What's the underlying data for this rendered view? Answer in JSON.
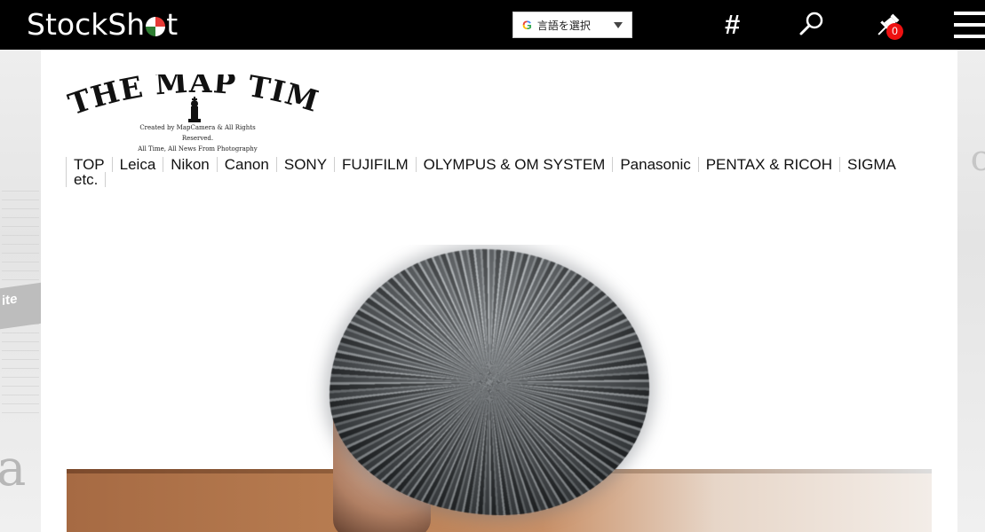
{
  "header": {
    "brand_left": "Stock",
    "brand_right": "Sh",
    "brand_tail": "t",
    "language_select": {
      "label": "言語を選択"
    },
    "hash_label": "#",
    "pin_count": "0"
  },
  "logo": {
    "title": "THE MAP TIMES",
    "tagline_1": "Created by MapCamera & All Rights Reserved.",
    "tagline_2": "All Time, All News From Photography"
  },
  "nav": {
    "items": [
      "TOP",
      "Leica",
      "Nikon",
      "Canon",
      "SONY",
      "FUJIFILM",
      "OLYMPUS & OM SYSTEM",
      "Panasonic",
      "PENTAX & RICOH",
      "SIGMA"
    ],
    "row2": [
      "etc."
    ]
  },
  "background": {
    "left_strip_text": "ite",
    "left_big_letter": "a",
    "right_big_letter": "c"
  }
}
